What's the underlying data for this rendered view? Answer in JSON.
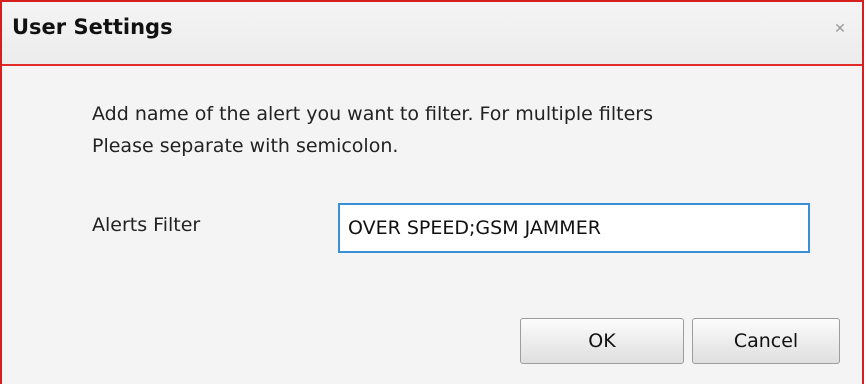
{
  "dialog": {
    "title": "User Settings",
    "close_icon": "close-icon"
  },
  "message": {
    "line1": "Add name of the alert you want to filter. For multiple filters",
    "line2": "Please separate with semicolon."
  },
  "alerts_filter": {
    "label": "Alerts Filter",
    "value": "OVER SPEED;GSM JAMMER"
  },
  "buttons": {
    "ok_label": "OK",
    "cancel_label": "Cancel"
  },
  "colors": {
    "border": "#d61e1e",
    "input_border": "#3b8fd6"
  }
}
